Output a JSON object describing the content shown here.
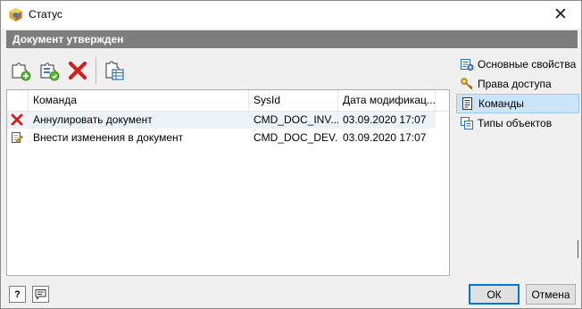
{
  "window": {
    "title": "Статус",
    "close_glyph": "✕"
  },
  "header": {
    "title": "Документ утвержден"
  },
  "toolbar": {
    "buttons": [
      {
        "name": "add-command-button",
        "icon": "puzzle-add-icon"
      },
      {
        "name": "edit-command-button",
        "icon": "puzzle-edit-icon"
      },
      {
        "name": "delete-command-button",
        "icon": "delete-x-icon"
      },
      {
        "name": "properties-button",
        "icon": "puzzle-table-icon"
      }
    ]
  },
  "grid": {
    "columns": [
      "Команда",
      "SysId",
      "Дата модификац..."
    ],
    "rows": [
      {
        "icon": "red-x-icon",
        "command": "Аннулировать документ",
        "sysid": "CMD_DOC_INV...",
        "date": "03.09.2020 17:07"
      },
      {
        "icon": "edit-document-icon",
        "command": "Внести изменения в документ",
        "sysid": "CMD_DOC_DEV...",
        "date": "03.09.2020 17:07"
      }
    ]
  },
  "sidebar": {
    "items": [
      {
        "label": "Основные свойства",
        "icon": "properties-icon",
        "active": false
      },
      {
        "label": "Права доступа",
        "icon": "keys-icon",
        "active": false
      },
      {
        "label": "Команды",
        "icon": "commands-icon",
        "active": true
      },
      {
        "label": "Типы объектов",
        "icon": "object-types-icon",
        "active": false
      }
    ]
  },
  "footer": {
    "ok_label": "ОК",
    "cancel_label": "Отмена",
    "help_glyph": "?"
  },
  "colors": {
    "header_band": "#7d7d7d",
    "selected_item": "#cce4f7",
    "accent": "#0078d7"
  }
}
